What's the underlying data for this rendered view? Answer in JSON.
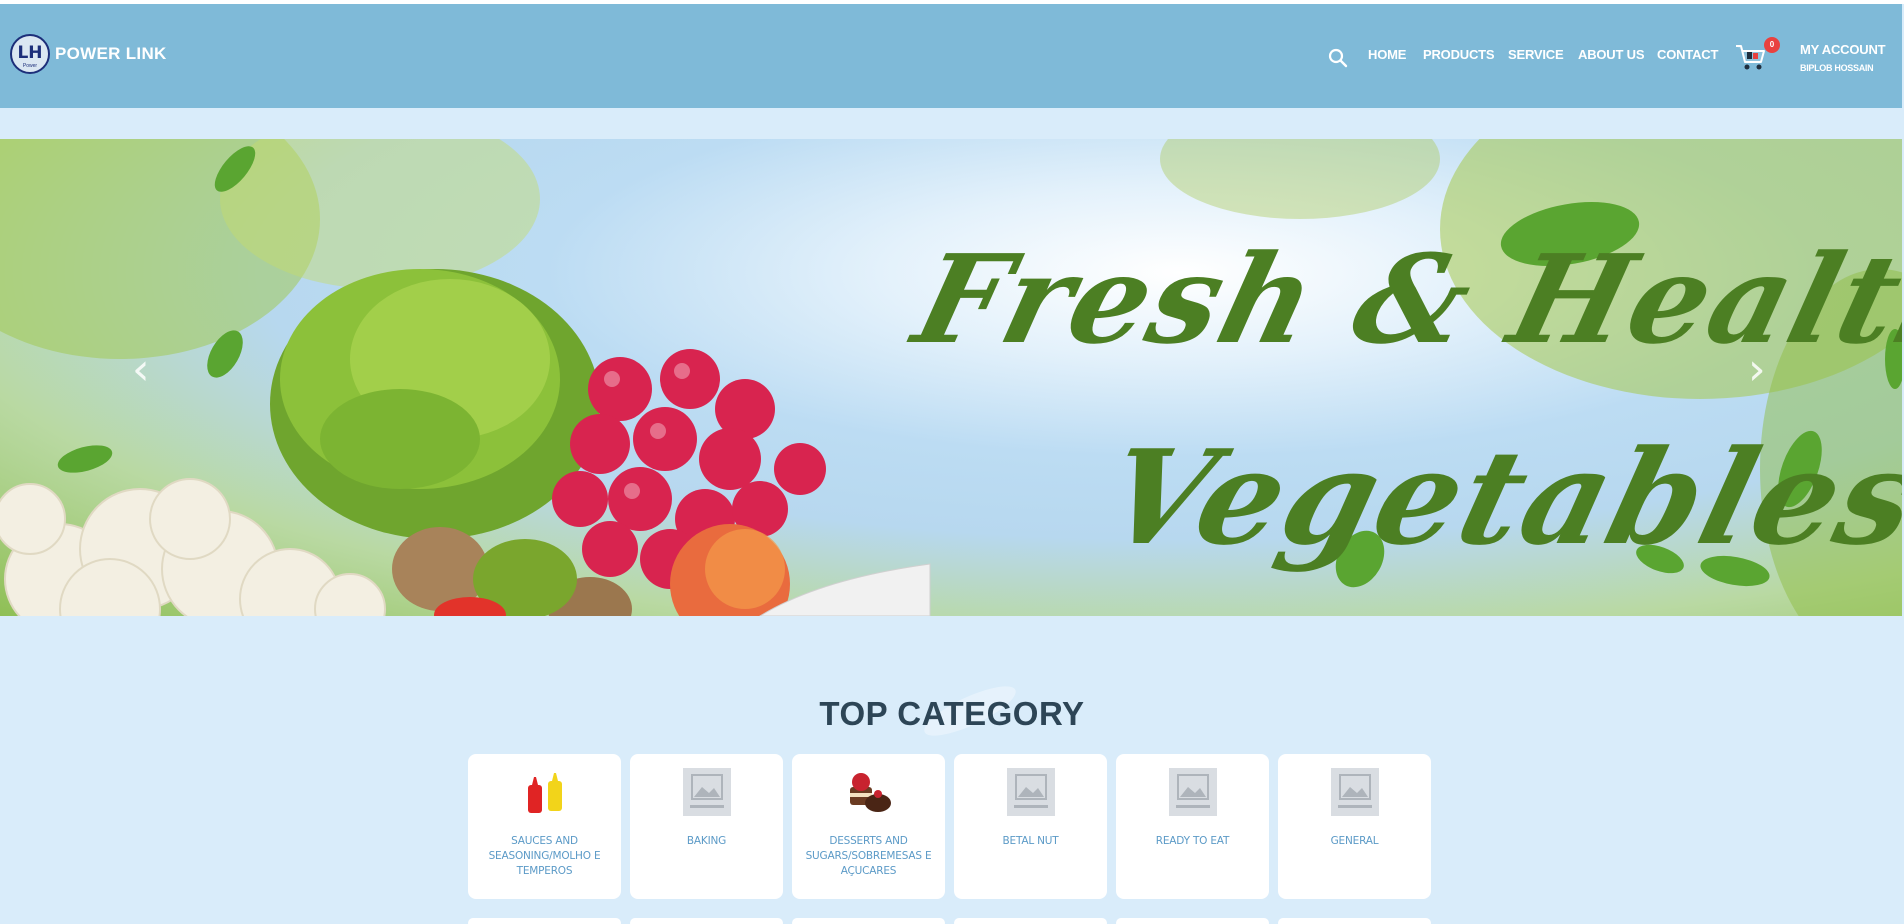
{
  "brand": {
    "name": "POWER LINK",
    "mark": "LH",
    "mark_sub": "Power"
  },
  "nav": {
    "items": [
      "HOME",
      "PRODUCTS",
      "SERVICE",
      "ABOUT US",
      "CONTACT"
    ],
    "search_icon": "search-icon",
    "cart_icon": "cart-icon",
    "cart_count": "0",
    "account_label": "MY ACCOUNT",
    "account_user": "BIPLOB HOSSAIN"
  },
  "hero": {
    "line1": "Fresh & Healthy",
    "line2": "Vegetables",
    "prev_icon": "chevron-left-icon",
    "next_icon": "chevron-right-icon"
  },
  "top_category": {
    "title": "TOP CATEGORY",
    "items": [
      {
        "label": "SAUCES AND SEASONING/MOLHO E TEMPEROS",
        "icon": "sauce-bottles-icon"
      },
      {
        "label": "BAKING",
        "icon": "no-image-icon"
      },
      {
        "label": "DESSERTS AND SUGARS/SOBREMESAS E AÇUCARES",
        "icon": "cake-icon"
      },
      {
        "label": "BETAL NUT",
        "icon": "no-image-icon"
      },
      {
        "label": "READY TO EAT",
        "icon": "no-image-icon"
      },
      {
        "label": "GENERAL",
        "icon": "no-image-icon"
      }
    ]
  },
  "colors": {
    "header": "#7fbad8",
    "page": "#d9ecfa",
    "title": "#2d4556",
    "category_text": "#5b9ac7",
    "hero_script": "#4c7f23",
    "badge": "#e9413f"
  }
}
